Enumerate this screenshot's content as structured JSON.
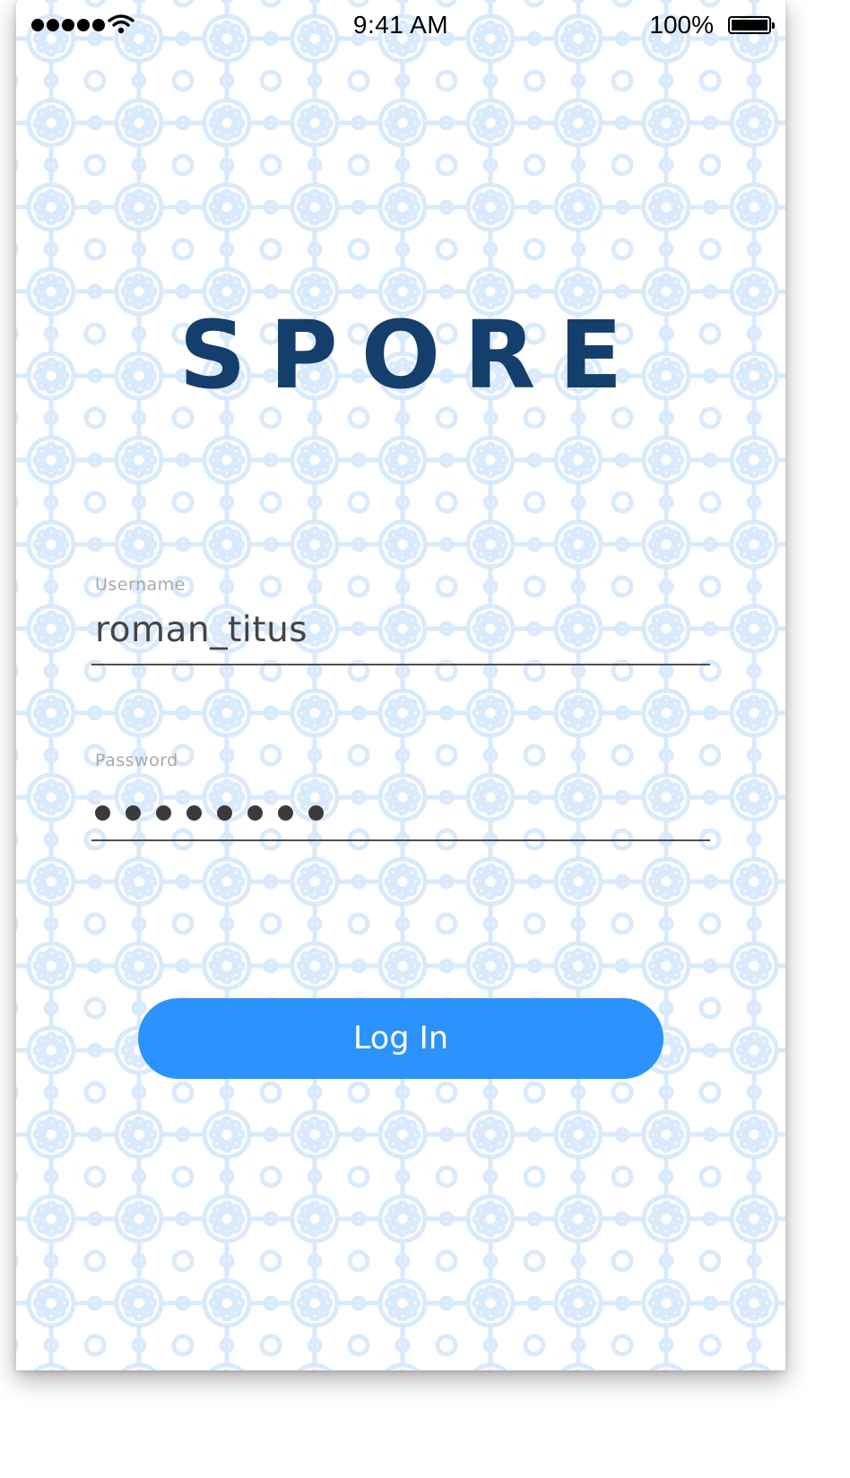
{
  "status_bar": {
    "time": "9:41 AM",
    "battery_percent": "100%",
    "signal_bars": 5,
    "icons": [
      "signal-icon",
      "wifi-icon",
      "battery-icon"
    ]
  },
  "app": {
    "logo_text": "SPORE"
  },
  "form": {
    "username": {
      "label": "Username",
      "value": "roman_titus"
    },
    "password": {
      "label": "Password",
      "masked_length": 8
    },
    "login_label": "Log In"
  },
  "colors": {
    "brand": "#143e6c",
    "accent": "#2b93fb",
    "pattern": "#d7e9fb",
    "label": "#a8a8a8",
    "text": "#444444"
  }
}
